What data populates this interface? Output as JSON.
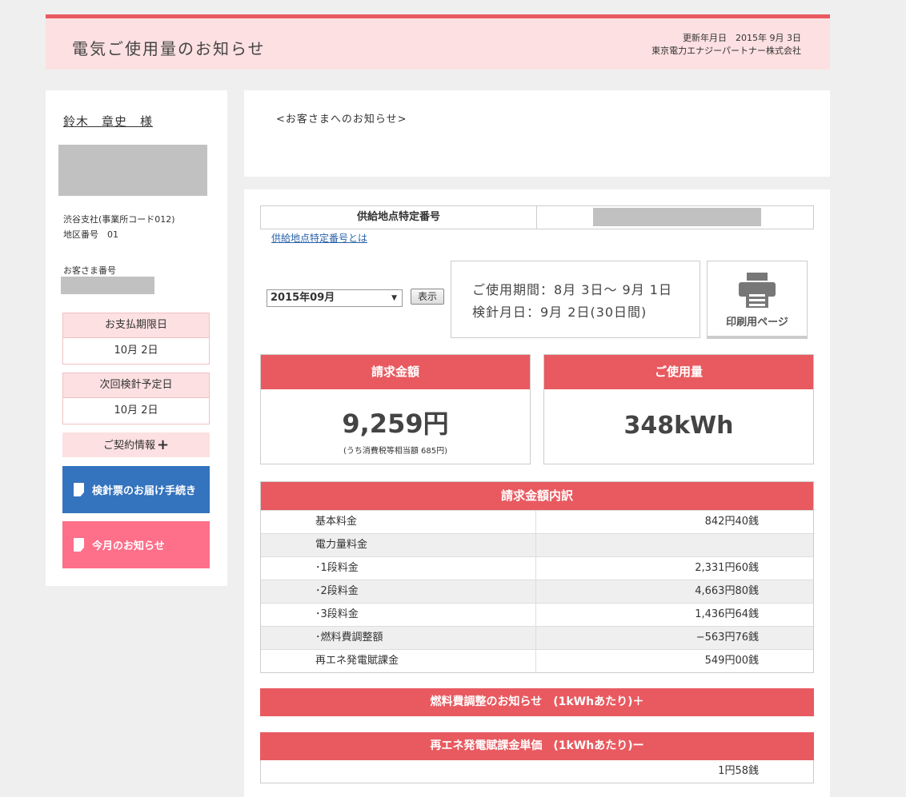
{
  "header": {
    "title": "電気ご使用量のお知らせ",
    "update_date": "更新年月日　2015年 9月 3日",
    "company": "東京電力エナジーパートナー株式会社"
  },
  "sidebar": {
    "customer_name": "鈴木　章史　様",
    "branch": "渋谷支社(事業所コード012)",
    "district": "地区番号　01",
    "customer_number_label": "お客さま番号",
    "payment_due_label": "お支払期限日",
    "payment_due_value": "10月 2日",
    "next_reading_label": "次回検針予定日",
    "next_reading_value": "10月 2日",
    "contract_label": "ご契約情報",
    "contract_toggle": "+",
    "meter_slip_button": "検針票のお届け手続き",
    "monthly_notice_button": "今月のお知らせ"
  },
  "notice": {
    "title": "<お客さまへのお知らせ>"
  },
  "supply": {
    "label": "供給地点特定番号",
    "link": "供給地点特定番号とは"
  },
  "controls": {
    "month_selected": "2015年09月",
    "show_button": "表示",
    "print_button": "印刷用ページ"
  },
  "period": {
    "usage_period": "ご使用期間：8月 3日～ 9月 1日",
    "reading_date": "検針月日：9月 2日(30日間)"
  },
  "billing": {
    "label": "請求金額",
    "amount": "9,259円",
    "tax_note": "(うち消費税等相当額 685円)"
  },
  "usage": {
    "label": "ご使用量",
    "value": "348kWh"
  },
  "breakdown": {
    "title": "請求金額内訳",
    "rows": [
      {
        "label": "基本料金",
        "value": "842円40銭"
      },
      {
        "label": "電力量料金",
        "value": ""
      },
      {
        "label": "･1段料金",
        "value": "2,331円60銭"
      },
      {
        "label": "･2段料金",
        "value": "4,663円80銭"
      },
      {
        "label": "･3段料金",
        "value": "1,436円64銭"
      },
      {
        "label": "･燃料費調整額",
        "value": "−563円76銭"
      },
      {
        "label": "再エネ発電賦課金",
        "value": "549円00銭"
      }
    ]
  },
  "fuel_adjustment": {
    "label": "燃料費調整のお知らせ　(1kWhあたり)＋"
  },
  "renewable": {
    "label": "再エネ発電賦課金単価　(1kWhあたり)ー",
    "value": "1円58銭"
  },
  "colors": {
    "accent": "#e85a60",
    "header_bg": "#fde0e1",
    "blue_button": "#3473bd",
    "pink_button": "#fe6f8a"
  }
}
